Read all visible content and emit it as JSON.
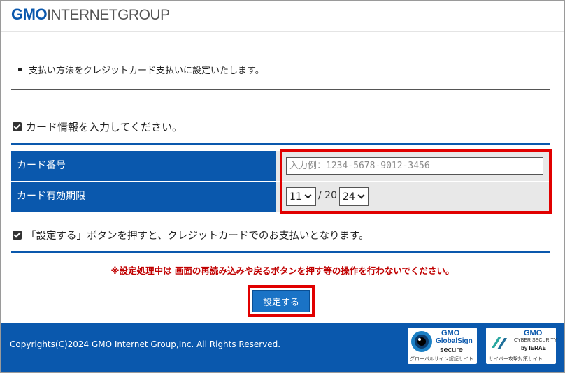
{
  "header": {
    "logo_bold": "GMO",
    "logo_rest": "INTERNETGROUP"
  },
  "notice": {
    "text": "支払い方法をクレジットカード支払いに設定いたします。"
  },
  "card_section": {
    "checkbox_label": "カード情報を入力してください。",
    "checked": true
  },
  "form": {
    "card_number_label": "カード番号",
    "card_number_placeholder": "入力例：1234-5678-9012-3456",
    "card_number_value": "",
    "expiry_label": "カード有効期限",
    "expiry_month": "11",
    "expiry_separator": "/ 20",
    "expiry_year": "24"
  },
  "agreement": {
    "checkbox_label": "「設定する」ボタンを押すと、クレジットカードでのお支払いとなります。",
    "checked": true
  },
  "warning": {
    "text": "※設定処理中は 画面の再読み込みや戻るボタンを押す等の操作を行わないでください。"
  },
  "submit": {
    "label": "設定する"
  },
  "footer": {
    "copyright": "Copyrights(C)2024 GMO Internet Group,Inc. All Rights Reserved.",
    "badge1": {
      "brand": "GMO",
      "name1": "GlobalSign",
      "name2": "secure",
      "caption": "グローバルサイン認証サイト"
    },
    "badge2": {
      "brand": "GMO",
      "name1": "CYBER SECURITY",
      "name2": "by IERAE",
      "caption": "サイバー攻撃対策サイト"
    }
  },
  "colors": {
    "primary_blue": "#0a58ad",
    "highlight_red": "#e10000",
    "warning_red": "#c00000",
    "button_blue": "#1a73c6"
  }
}
